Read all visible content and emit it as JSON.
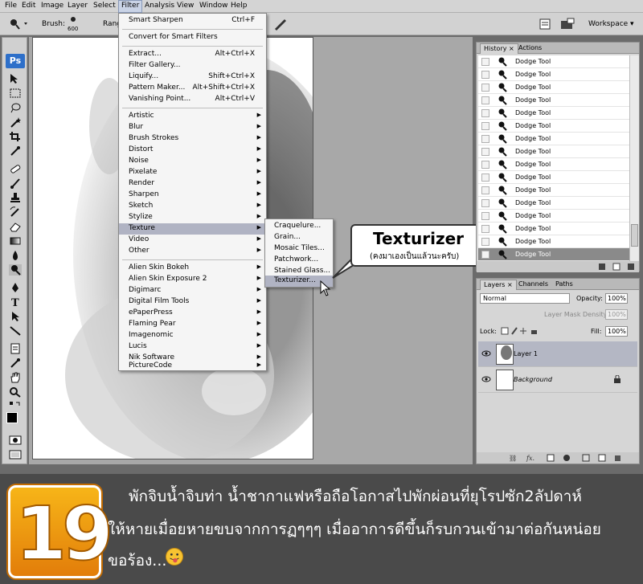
{
  "menubar": {
    "items": [
      "File",
      "Edit",
      "Image",
      "Layer",
      "Select",
      "Filter",
      "Analysis",
      "View",
      "Window",
      "Help"
    ],
    "active": "Filter"
  },
  "options": {
    "brush_label": "Brush:",
    "brush_size": "600",
    "range_label": "Rang",
    "workspace_label": "Workspace ▾"
  },
  "toolbox": {
    "logo": "Ps"
  },
  "filter_menu": {
    "top": [
      {
        "label": "Smart Sharpen",
        "shortcut": "Ctrl+F"
      },
      {
        "label": "Convert for Smart Filters",
        "shortcut": ""
      }
    ],
    "group2": [
      {
        "label": "Extract...",
        "shortcut": "Alt+Ctrl+X"
      },
      {
        "label": "Filter Gallery...",
        "shortcut": ""
      },
      {
        "label": "Liquify...",
        "shortcut": "Shift+Ctrl+X"
      },
      {
        "label": "Pattern Maker...",
        "shortcut": "Alt+Shift+Ctrl+X"
      },
      {
        "label": "Vanishing Point...",
        "shortcut": "Alt+Ctrl+V"
      }
    ],
    "group3": [
      "Artistic",
      "Blur",
      "Brush Strokes",
      "Distort",
      "Noise",
      "Pixelate",
      "Render",
      "Sharpen",
      "Sketch",
      "Stylize",
      "Texture",
      "Video",
      "Other"
    ],
    "group4": [
      "Alien Skin Bokeh",
      "Alien Skin Exposure 2",
      "Digimarc",
      "Digital Film Tools",
      "ePaperPress",
      "Flaming Pear",
      "Imagenomic",
      "Lucis",
      "Nik Software",
      "PictureCode"
    ],
    "highlighted": "Texture"
  },
  "texture_submenu": {
    "items": [
      "Craquelure...",
      "Grain...",
      "Mosaic Tiles...",
      "Patchwork...",
      "Stained Glass...",
      "Texturizer..."
    ],
    "highlighted": "Texturizer..."
  },
  "callout": {
    "title": "Texturizer",
    "subtitle": "(คงมาเองเป็นแล้วนะครับ)"
  },
  "history": {
    "tabs": [
      "History ×",
      "Actions"
    ],
    "items": [
      "Dodge Tool",
      "Dodge Tool",
      "Dodge Tool",
      "Dodge Tool",
      "Dodge Tool",
      "Dodge Tool",
      "Dodge Tool",
      "Dodge Tool",
      "Dodge Tool",
      "Dodge Tool",
      "Dodge Tool",
      "Dodge Tool",
      "Dodge Tool",
      "Dodge Tool",
      "Dodge Tool",
      "Dodge Tool"
    ],
    "selected_index": 15
  },
  "layers": {
    "tabs": [
      "Layers ×",
      "Channels",
      "Paths"
    ],
    "blend_mode": "Normal",
    "opacity_label": "Opacity:",
    "opacity": "100%",
    "layer_mask_density_label": "Layer Mask Density:",
    "layer_mask_density": "100%",
    "lock_label": "Lock:",
    "fill_label": "Fill:",
    "fill": "100%",
    "items": [
      {
        "name": "Layer 1",
        "selected": true
      },
      {
        "name": "Background",
        "selected": false
      }
    ]
  },
  "banner": {
    "number": "19",
    "line1": "พักจิบน้ำจิบท่า น้ำชากาแฟหรือถือโอกาสไปพักผ่อนที่ยุโรปซัก2ลัปดาห์",
    "line2": "ให้หายเมื่อยหายขบจากการฏๆๆๆ เมื่ออาการดีขึ้นก็รบกวนเข้ามาต่อกันหน่อย",
    "line3": "ขอร้อง..."
  },
  "colors": {
    "menu_highlight": "#b0b3c3",
    "banner_bg": "#4a4a4a",
    "badge_orange": "#f7b518"
  }
}
